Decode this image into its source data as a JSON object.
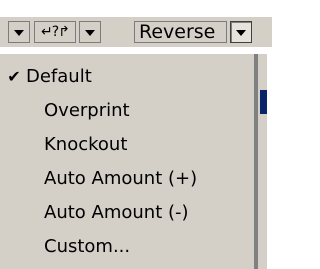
{
  "toolbar": {
    "overprint_symbol": "↵?↱",
    "reverse_label": "Reverse"
  },
  "menu": {
    "items": [
      {
        "label": "Default",
        "checked": true
      },
      {
        "label": "Overprint",
        "checked": false
      },
      {
        "label": "Knockout",
        "checked": false
      },
      {
        "label": "Auto Amount (+)",
        "checked": false
      },
      {
        "label": "Auto Amount (-)",
        "checked": false
      },
      {
        "label": "Custom...",
        "checked": false
      }
    ],
    "check_glyph": "✔"
  },
  "colors": {
    "menu_background": "#d4d0c8",
    "accent": "#0a246a"
  }
}
